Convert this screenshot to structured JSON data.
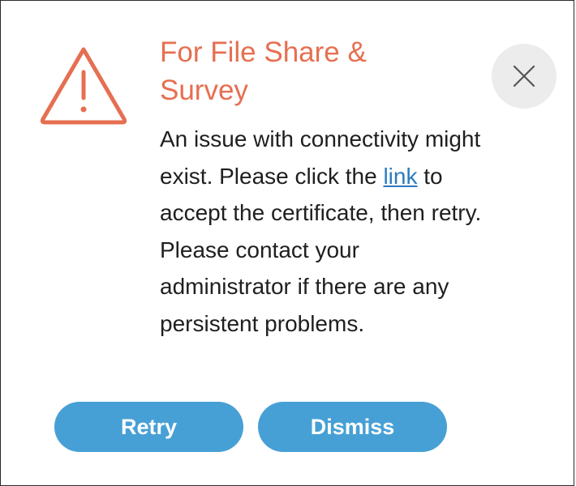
{
  "dialog": {
    "title": "For File Share & Survey",
    "message_before_link": "An issue with connectivity might exist. Please click the ",
    "link_text": "link",
    "message_after_link": " to accept the certificate, then retry. Please contact your administrator if there are any persistent problems.",
    "icon": "warning-triangle-icon",
    "close_icon": "close-icon"
  },
  "buttons": {
    "retry_label": "Retry",
    "dismiss_label": "Dismiss"
  },
  "colors": {
    "title": "#e66f51",
    "warning_icon": "#e66f51",
    "button_bg": "#47a0d5",
    "link": "#2a7bbf",
    "close_bg": "#ececec"
  }
}
